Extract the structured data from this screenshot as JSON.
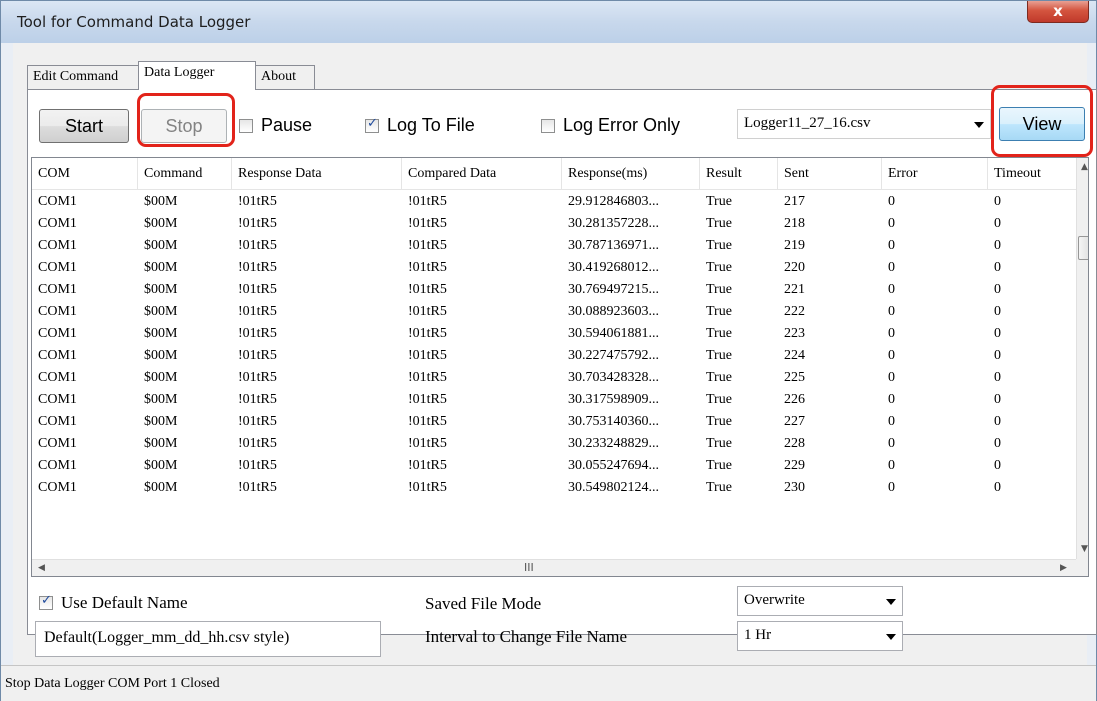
{
  "window": {
    "title": "Tool for Command Data Logger",
    "close_glyph": "x"
  },
  "tabs": [
    {
      "label": "Edit Command",
      "active": false
    },
    {
      "label": "Data Logger",
      "active": true
    },
    {
      "label": "About",
      "active": false
    }
  ],
  "toolbar": {
    "start_label": "Start",
    "stop_label": "Stop",
    "pause_label": "Pause",
    "pause_checked": false,
    "log_to_file_label": "Log To File",
    "log_to_file_checked": true,
    "log_error_only_label": "Log Error Only",
    "log_error_only_checked": false,
    "file_select_value": "Logger11_27_16.csv",
    "view_label": "View"
  },
  "grid": {
    "columns": [
      "COM",
      "Command",
      "Response Data",
      "Compared Data",
      "Response(ms)",
      "Result",
      "Sent",
      "Error",
      "Timeout"
    ],
    "rows": [
      [
        "COM1",
        "$00M",
        "!01tR5",
        "!01tR5",
        "29.912846803...",
        "True",
        "217",
        "0",
        "0"
      ],
      [
        "COM1",
        "$00M",
        "!01tR5",
        "!01tR5",
        "30.281357228...",
        "True",
        "218",
        "0",
        "0"
      ],
      [
        "COM1",
        "$00M",
        "!01tR5",
        "!01tR5",
        "30.787136971...",
        "True",
        "219",
        "0",
        "0"
      ],
      [
        "COM1",
        "$00M",
        "!01tR5",
        "!01tR5",
        "30.419268012...",
        "True",
        "220",
        "0",
        "0"
      ],
      [
        "COM1",
        "$00M",
        "!01tR5",
        "!01tR5",
        "30.769497215...",
        "True",
        "221",
        "0",
        "0"
      ],
      [
        "COM1",
        "$00M",
        "!01tR5",
        "!01tR5",
        "30.088923603...",
        "True",
        "222",
        "0",
        "0"
      ],
      [
        "COM1",
        "$00M",
        "!01tR5",
        "!01tR5",
        "30.594061881...",
        "True",
        "223",
        "0",
        "0"
      ],
      [
        "COM1",
        "$00M",
        "!01tR5",
        "!01tR5",
        "30.227475792...",
        "True",
        "224",
        "0",
        "0"
      ],
      [
        "COM1",
        "$00M",
        "!01tR5",
        "!01tR5",
        "30.703428328...",
        "True",
        "225",
        "0",
        "0"
      ],
      [
        "COM1",
        "$00M",
        "!01tR5",
        "!01tR5",
        "30.317598909...",
        "True",
        "226",
        "0",
        "0"
      ],
      [
        "COM1",
        "$00M",
        "!01tR5",
        "!01tR5",
        "30.753140360...",
        "True",
        "227",
        "0",
        "0"
      ],
      [
        "COM1",
        "$00M",
        "!01tR5",
        "!01tR5",
        "30.233248829...",
        "True",
        "228",
        "0",
        "0"
      ],
      [
        "COM1",
        "$00M",
        "!01tR5",
        "!01tR5",
        "30.055247694...",
        "True",
        "229",
        "0",
        "0"
      ],
      [
        "COM1",
        "$00M",
        "!01tR5",
        "!01tR5",
        "30.549802124...",
        "True",
        "230",
        "0",
        "0"
      ]
    ],
    "hscroll_grip": "III"
  },
  "bottom": {
    "use_default_name_label": "Use Default Name",
    "use_default_name_checked": true,
    "default_name_value": "Default(Logger_mm_dd_hh.csv style)",
    "saved_file_mode_label": "Saved File Mode",
    "saved_file_mode_value": "Overwrite",
    "interval_label": "Interval to Change File Name",
    "interval_value": "1 Hr"
  },
  "status": {
    "text": "Stop Data Logger COM Port 1 Closed"
  },
  "colors": {
    "highlight_ring": "#e2231a"
  }
}
